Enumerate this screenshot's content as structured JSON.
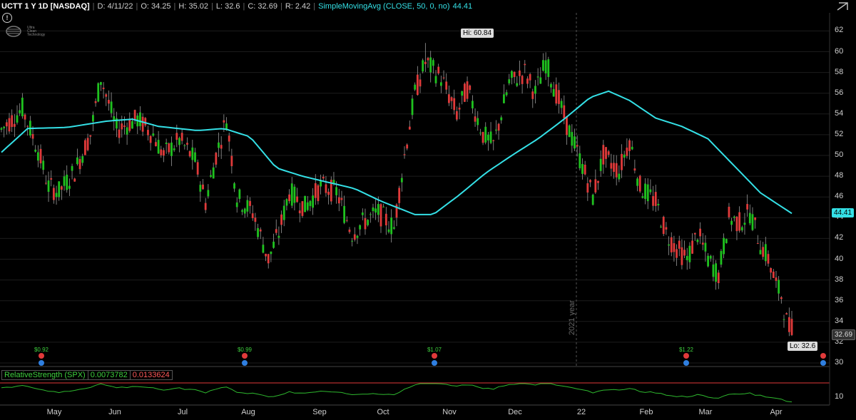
{
  "header": {
    "symbol": "UCTT 1 Y 1D [NASDAQ]",
    "date": "D: 4/11/22",
    "open": "O: 34.25",
    "high": "H: 35.02",
    "low": "L: 32.6",
    "close": "C: 32.69",
    "range": "R: 2.42",
    "sma_label": "SimpleMovingAvg (CLOSE, 50, 0, no)",
    "sma_value": "44.41"
  },
  "logo_text": [
    "Ultra",
    "Clean",
    "Technology"
  ],
  "price_badges": {
    "last_sma": "44.41",
    "close": "32.69"
  },
  "callouts": {
    "high": "Hi: 60.84",
    "low": "Lo: 32.6"
  },
  "year_label": "2021 year",
  "earnings": [
    {
      "label": "$0.92"
    },
    {
      "label": "$0.99"
    },
    {
      "label": "$1.07"
    },
    {
      "label": "$1.22"
    }
  ],
  "relative_strength": {
    "label": "RelativeStrength (SPX)",
    "value1": "0.0073782",
    "value2": "0.0133624",
    "axis_label": "10"
  },
  "colors": {
    "up": "#1fc21f",
    "down": "#e03a3a",
    "sma": "#34e0e6",
    "rs": "#2eb82e",
    "grid": "#1c1c1c"
  },
  "chart_data": {
    "type": "candlestick",
    "ylim": [
      30,
      63
    ],
    "yticks": [
      30,
      32,
      34,
      36,
      38,
      40,
      42,
      44,
      46,
      48,
      50,
      52,
      54,
      56,
      58,
      60,
      62
    ],
    "x_months": [
      "May",
      "Jun",
      "Jul",
      "Aug",
      "Sep",
      "Oct",
      "Nov",
      "Dec",
      "22",
      "Feb",
      "Mar",
      "Apr"
    ],
    "close_path": [
      [
        0,
        52.5
      ],
      [
        8,
        54.5
      ],
      [
        14,
        50.5
      ],
      [
        18,
        47
      ],
      [
        22,
        46.5
      ],
      [
        28,
        48.5
      ],
      [
        34,
        52
      ],
      [
        38,
        57.5
      ],
      [
        44,
        52.5
      ],
      [
        52,
        53.5
      ],
      [
        58,
        52
      ],
      [
        62,
        50
      ],
      [
        68,
        51.5
      ],
      [
        74,
        49.5
      ],
      [
        78,
        45.5
      ],
      [
        82,
        50
      ],
      [
        86,
        53.5
      ],
      [
        90,
        46
      ],
      [
        96,
        44.5
      ],
      [
        102,
        40
      ],
      [
        106,
        42.5
      ],
      [
        110,
        46.5
      ],
      [
        116,
        45
      ],
      [
        122,
        47
      ],
      [
        128,
        46.5
      ],
      [
        134,
        42.5
      ],
      [
        138,
        43.5
      ],
      [
        144,
        44.5
      ],
      [
        150,
        43
      ],
      [
        154,
        50
      ],
      [
        158,
        56
      ],
      [
        162,
        59
      ],
      [
        168,
        57.5
      ],
      [
        174,
        54
      ],
      [
        178,
        56.5
      ],
      [
        184,
        52
      ],
      [
        188,
        51
      ],
      [
        194,
        57
      ],
      [
        200,
        58
      ],
      [
        204,
        56
      ],
      [
        208,
        59
      ],
      [
        212,
        56
      ],
      [
        216,
        53
      ],
      [
        222,
        49
      ],
      [
        226,
        46
      ],
      [
        230,
        50
      ],
      [
        236,
        48.5
      ],
      [
        240,
        51.5
      ],
      [
        244,
        47
      ],
      [
        250,
        45.5
      ],
      [
        254,
        42.5
      ],
      [
        258,
        41
      ],
      [
        262,
        40
      ],
      [
        266,
        42.5
      ],
      [
        270,
        40
      ],
      [
        274,
        38.5
      ],
      [
        278,
        44
      ],
      [
        282,
        43.5
      ],
      [
        286,
        44.5
      ],
      [
        290,
        41.5
      ],
      [
        293,
        40
      ],
      [
        296,
        37.5
      ],
      [
        298,
        36.5
      ],
      [
        300,
        34
      ],
      [
        302,
        32.69
      ]
    ],
    "sma_50": [
      [
        0,
        50.3
      ],
      [
        10,
        52.6
      ],
      [
        25,
        52.7
      ],
      [
        40,
        53.3
      ],
      [
        50,
        53.5
      ],
      [
        60,
        52.8
      ],
      [
        75,
        52.4
      ],
      [
        85,
        52.6
      ],
      [
        95,
        51.8
      ],
      [
        105,
        48.8
      ],
      [
        115,
        48
      ],
      [
        125,
        47.4
      ],
      [
        135,
        46.8
      ],
      [
        145,
        45.6
      ],
      [
        158,
        44.3
      ],
      [
        165,
        44.3
      ],
      [
        175,
        46.2
      ],
      [
        185,
        48.3
      ],
      [
        195,
        50
      ],
      [
        205,
        51.6
      ],
      [
        215,
        53.5
      ],
      [
        225,
        55.6
      ],
      [
        232,
        56.2
      ],
      [
        240,
        55.3
      ],
      [
        250,
        53.6
      ],
      [
        260,
        52.8
      ],
      [
        270,
        51.6
      ],
      [
        280,
        49
      ],
      [
        290,
        46.4
      ],
      [
        302,
        44.41
      ]
    ],
    "high": {
      "value": 60.84,
      "day": 162
    },
    "low": {
      "value": 32.6,
      "day": 302
    },
    "last": {
      "close": 32.69,
      "sma": 44.41
    }
  }
}
